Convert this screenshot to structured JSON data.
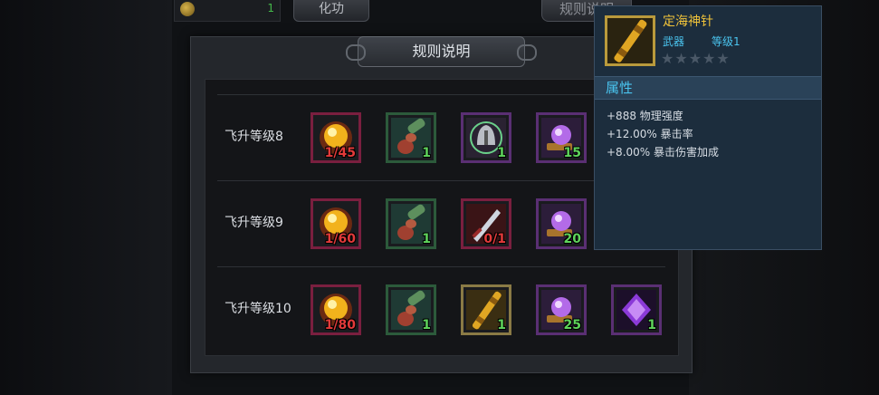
{
  "header": {
    "count": "1",
    "button_left": "化功",
    "button_right": "规则说明"
  },
  "modal": {
    "title": "规则说明",
    "rows": [
      {
        "label": "飞升等级8",
        "items": [
          {
            "icon": "sun-orb-icon",
            "qty": "1/45",
            "qty_state": "need"
          },
          {
            "icon": "jade-gourd-icon",
            "qty": "1",
            "qty_state": "have"
          },
          {
            "icon": "helmet-icon",
            "qty": "1",
            "qty_state": "have"
          },
          {
            "icon": "purple-orb-icon",
            "qty": "15",
            "qty_state": "have"
          }
        ]
      },
      {
        "label": "飞升等级9",
        "items": [
          {
            "icon": "sun-orb-icon",
            "qty": "1/60",
            "qty_state": "need"
          },
          {
            "icon": "jade-gourd-icon",
            "qty": "1",
            "qty_state": "have"
          },
          {
            "icon": "dagger-icon",
            "qty": "0/1",
            "qty_state": "need"
          },
          {
            "icon": "purple-orb-icon",
            "qty": "20",
            "qty_state": "have"
          }
        ]
      },
      {
        "label": "飞升等级10",
        "items": [
          {
            "icon": "sun-orb-icon",
            "qty": "1/80",
            "qty_state": "need"
          },
          {
            "icon": "jade-gourd-icon",
            "qty": "1",
            "qty_state": "have"
          },
          {
            "icon": "golden-staff-icon",
            "qty": "1",
            "qty_state": "have"
          },
          {
            "icon": "purple-orb-icon",
            "qty": "25",
            "qty_state": "have"
          },
          {
            "icon": "purple-crystal-icon",
            "qty": "1",
            "qty_state": "have"
          }
        ]
      }
    ]
  },
  "tooltip": {
    "name": "定海神针",
    "type": "武器",
    "level": "等级1",
    "stars": "★★★★★",
    "attr_title": "属性",
    "attrs": [
      "+888 物理强度",
      "+12.00% 暴击率",
      "+8.00% 暴击伤害加成"
    ]
  },
  "colors": {
    "need": "#e23a3a",
    "have": "#5ed35b",
    "name": "#f0c33a",
    "accent_blue": "#4ac4ef"
  }
}
